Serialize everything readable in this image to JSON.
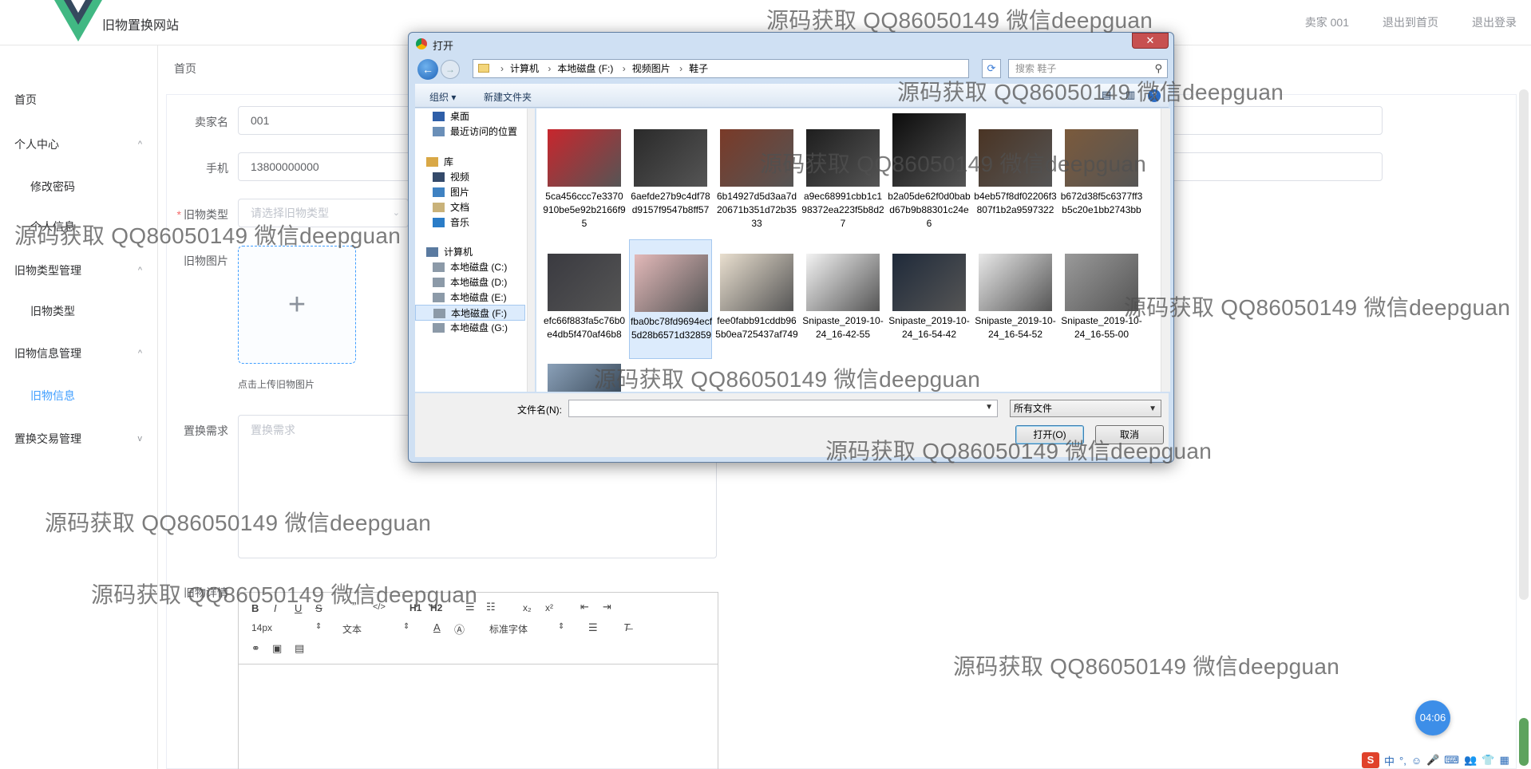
{
  "header": {
    "site_title": "旧物置换网站",
    "links": [
      "卖家 001",
      "退出到首页",
      "退出登录"
    ]
  },
  "sidebar": {
    "items": [
      {
        "label": "首页",
        "type": "top"
      },
      {
        "label": "个人中心",
        "type": "group",
        "arrow": "^"
      },
      {
        "label": "修改密码",
        "type": "sub"
      },
      {
        "label": "个人信息",
        "type": "sub"
      },
      {
        "label": "旧物类型管理",
        "type": "group",
        "arrow": "^"
      },
      {
        "label": "旧物类型",
        "type": "sub"
      },
      {
        "label": "旧物信息管理",
        "type": "group",
        "arrow": "^"
      },
      {
        "label": "旧物信息",
        "type": "sub",
        "active": true
      },
      {
        "label": "置换交易管理",
        "type": "group",
        "arrow": "v"
      }
    ]
  },
  "breadcrumb": "首页",
  "form": {
    "seller_name_label": "卖家名",
    "seller_name_value": "001",
    "phone_label": "手机",
    "phone_value": "13800000000",
    "type_label": "旧物类型",
    "type_placeholder": "请选择旧物类型",
    "image_label": "旧物图片",
    "upload_tip": "点击上传旧物图片",
    "demand_label": "置换需求",
    "demand_placeholder": "置换需求",
    "detail_label": "旧物详情",
    "font_size": "14px",
    "text_style": "文本",
    "font_family": "标准字体"
  },
  "dialog": {
    "title": "打开",
    "close": "✕",
    "path": [
      "计算机",
      "本地磁盘 (F:)",
      "视频图片",
      "鞋子"
    ],
    "search_placeholder": "搜索 鞋子",
    "organize": "组织 ▾",
    "new_folder": "新建文件夹",
    "nav_items": [
      {
        "label": "桌面",
        "icon": "desktop-icon",
        "color": "#2f5fa8"
      },
      {
        "label": "最近访问的位置",
        "icon": "recent-icon",
        "color": "#6a8fb8"
      },
      {
        "label": "库",
        "icon": "library-icon",
        "color": "#d9a846"
      },
      {
        "label": "视频",
        "icon": "video-icon",
        "color": "#344a6a"
      },
      {
        "label": "图片",
        "icon": "pictures-icon",
        "color": "#3f82c2"
      },
      {
        "label": "文档",
        "icon": "documents-icon",
        "color": "#c9b27a"
      },
      {
        "label": "音乐",
        "icon": "music-icon",
        "color": "#2a7cc7"
      },
      {
        "label": "计算机",
        "icon": "computer-icon",
        "color": "#5a7aa0"
      },
      {
        "label": "本地磁盘 (C:)",
        "icon": "drive-icon",
        "color": "#8c9aa8"
      },
      {
        "label": "本地磁盘 (D:)",
        "icon": "drive-icon",
        "color": "#8c9aa8"
      },
      {
        "label": "本地磁盘 (E:)",
        "icon": "drive-icon",
        "color": "#8c9aa8"
      },
      {
        "label": "本地磁盘 (F:)",
        "icon": "drive-icon",
        "color": "#8c9aa8",
        "selected": true
      },
      {
        "label": "本地磁盘 (G:)",
        "icon": "drive-icon",
        "color": "#8c9aa8"
      }
    ],
    "files": [
      {
        "name": "5ca456ccc7e3370910be5e92b2166f95",
        "color": "#c8262d"
      },
      {
        "name": "6aefde27b9c4df78d9157f9547b8ff57",
        "color": "#2a2a2a"
      },
      {
        "name": "6b14927d5d3aa7d20671b351d72b3533",
        "color": "#7a3a28"
      },
      {
        "name": "a9ec68991cbb1c198372ea223f5b8d27",
        "color": "#1e1e1e"
      },
      {
        "name": "b2a05de62f0d0babd67b9b88301c24e6",
        "color": "#0c0c0c"
      },
      {
        "name": "b4eb57f8df02206f3807f1b2a9597322",
        "color": "#4a3424"
      },
      {
        "name": "b672d38f5c6377ff3b5c20e1bb2743bb",
        "color": "#7b5a3c"
      },
      {
        "name": "efc66f883fa5c76b0e4db5f470af46b8",
        "color": "#3a3a40"
      },
      {
        "name": "fba0bc78fd9694ecf5d28b6571d32859",
        "color": "#e3b9b9",
        "selected": true
      },
      {
        "name": "fee0fabb91cddb965b0ea725437af749",
        "color": "#e9dfcf"
      },
      {
        "name": "Snipaste_2019-10-24_16-42-55",
        "color": "#f3f3f3"
      },
      {
        "name": "Snipaste_2019-10-24_16-54-42",
        "color": "#1f2a3a"
      },
      {
        "name": "Snipaste_2019-10-24_16-54-52",
        "color": "#e8e8e8"
      },
      {
        "name": "Snipaste_2019-10-24_16-55-00",
        "color": "#9a9a9a"
      }
    ],
    "filename_label": "文件名(N):",
    "filter_value": "所有文件",
    "open_button": "打开(O)",
    "cancel_button": "取消"
  },
  "watermarks": [
    "源码获取 QQ86050149 微信deepguan",
    "源码获取 QQ86050149 微信deepguan",
    "源码获取 QQ86050149 微信deepguan",
    "源码获取 QQ86050149 微信deepguan",
    "源码获取 QQ86050149 微信deepguan",
    "源码获取 QQ86050149 微信deepguan",
    "源码获取 QQ86050149 微信deepguan",
    "源码获取 QQ86050149 微信deepguan",
    "源码获取 QQ86050149 微信deepguan",
    "源码获取 QQ86050149 微信deepguan"
  ],
  "clock": "04:06",
  "tray": [
    "S",
    "中",
    "°,",
    "☺",
    "🎤",
    "⌨",
    "👥",
    "👕",
    "▦"
  ]
}
